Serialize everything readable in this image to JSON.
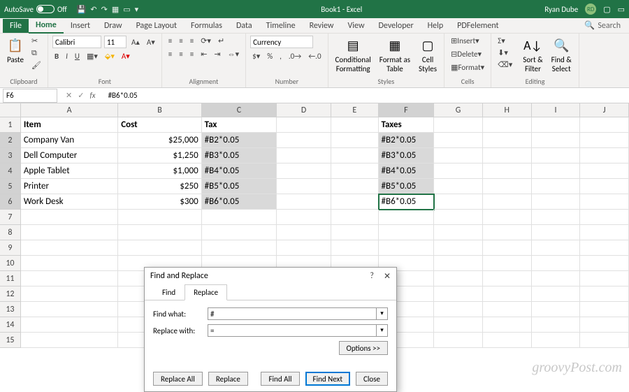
{
  "titlebar": {
    "autosave_label": "AutoSave",
    "autosave_state": "Off",
    "doc_title": "Book1 - Excel",
    "user_name": "Ryan Dube",
    "user_initials": "RD"
  },
  "menu": {
    "tabs": [
      "File",
      "Home",
      "Insert",
      "Draw",
      "Page Layout",
      "Formulas",
      "Data",
      "Timeline",
      "Review",
      "View",
      "Developer",
      "Help",
      "PDFelement"
    ],
    "active": "Home",
    "search_label": "Search"
  },
  "ribbon": {
    "clipboard": {
      "label": "Clipboard",
      "paste": "Paste"
    },
    "font": {
      "label": "Font",
      "name": "Calibri",
      "size": "11"
    },
    "alignment": {
      "label": "Alignment"
    },
    "number": {
      "label": "Number",
      "format": "Currency"
    },
    "styles": {
      "label": "Styles",
      "cond": "Conditional\nFormatting",
      "fmt_tbl": "Format as\nTable",
      "cell_styles": "Cell\nStyles"
    },
    "cells": {
      "label": "Cells",
      "insert": "Insert",
      "delete": "Delete",
      "format": "Format"
    },
    "editing": {
      "label": "Editing",
      "sort": "Sort &\nFilter",
      "find": "Find &\nSelect"
    }
  },
  "formula_bar": {
    "cell_ref": "F6",
    "formula": "#B6*0.05"
  },
  "columns": [
    "A",
    "B",
    "C",
    "D",
    "E",
    "F",
    "G",
    "H",
    "I",
    "J"
  ],
  "rows": [
    {
      "n": "1",
      "A": "Item",
      "B": "Cost",
      "C": "Tax",
      "D": "",
      "E": "",
      "F": "Taxes",
      "bold": true
    },
    {
      "n": "2",
      "A": "Company Van",
      "B": "$25,000",
      "C": "#B2*0.05",
      "F": "#B2*0.05"
    },
    {
      "n": "3",
      "A": "Dell Computer",
      "B": "$1,250",
      "C": "#B3*0.05",
      "F": "#B3*0.05"
    },
    {
      "n": "4",
      "A": "Apple Tablet",
      "B": "$1,000",
      "C": "#B4*0.05",
      "F": "#B4*0.05"
    },
    {
      "n": "5",
      "A": "Printer",
      "B": "$250",
      "C": "#B5*0.05",
      "F": "#B5*0.05"
    },
    {
      "n": "6",
      "A": "Work Desk",
      "B": "$300",
      "C": "#B6*0.05",
      "F": "#B6*0.05"
    }
  ],
  "dialog": {
    "title": "Find and Replace",
    "tabs": {
      "find": "Find",
      "replace": "Replace"
    },
    "find_what_label": "Find what:",
    "find_what_value": "#",
    "replace_with_label": "Replace with:",
    "replace_with_value": "=",
    "options": "Options >>",
    "buttons": {
      "replace_all": "Replace All",
      "replace": "Replace",
      "find_all": "Find All",
      "find_next": "Find Next",
      "close": "Close"
    }
  },
  "watermark": "groovyPost.com"
}
